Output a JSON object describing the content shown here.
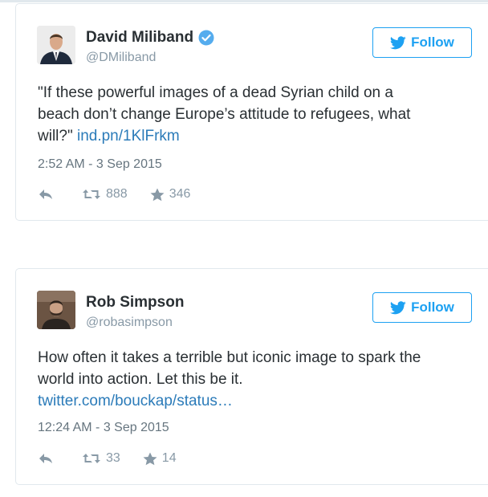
{
  "colors": {
    "link": "#2b7bb9",
    "follow_blue": "#1da1f2",
    "verified": "#55acee",
    "meta_gray": "#8899a6"
  },
  "tweets": [
    {
      "name": "David Miliband",
      "verified": true,
      "handle": "@DMiliband",
      "follow_label": "Follow",
      "text_line1": "\"If these powerful images of a dead Syrian child on a",
      "text_line2": "beach don’t change Europe’s attitude to refugees, what",
      "text_line3": "will?\"",
      "link": "ind.pn/1KlFrkm",
      "timestamp": "2:52 AM - 3 Sep 2015",
      "retweets": "888",
      "favorites": "346"
    },
    {
      "name": "Rob Simpson",
      "verified": false,
      "handle": "@robasimpson",
      "follow_label": "Follow",
      "text_line1": "How often it takes a terrible but iconic image to spark the",
      "text_line2": "world into action. Let this be it.",
      "link": "twitter.com/bouckap/status…",
      "timestamp": "12:24 AM - 3 Sep 2015",
      "retweets": "33",
      "favorites": "14"
    }
  ]
}
